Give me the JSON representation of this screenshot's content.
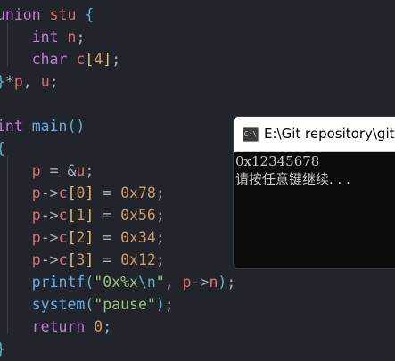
{
  "editor": {
    "lines": [
      [
        [
          "kw",
          "union"
        ],
        [
          "plain",
          " "
        ],
        [
          "id",
          "stu"
        ],
        [
          "plain",
          " "
        ],
        [
          "brace",
          "{"
        ]
      ],
      [
        [
          "plain",
          "    "
        ],
        [
          "kw",
          "int"
        ],
        [
          "plain",
          " "
        ],
        [
          "id",
          "n"
        ],
        [
          "plain",
          ";"
        ]
      ],
      [
        [
          "plain",
          "    "
        ],
        [
          "kw",
          "char"
        ],
        [
          "plain",
          " "
        ],
        [
          "id",
          "c"
        ],
        [
          "sq",
          "["
        ],
        [
          "num",
          "4"
        ],
        [
          "sq",
          "]"
        ],
        [
          "plain",
          ";"
        ]
      ],
      [
        [
          "brace",
          "}"
        ],
        [
          "plain",
          "*"
        ],
        [
          "id",
          "p"
        ],
        [
          "plain",
          ", "
        ],
        [
          "id",
          "u"
        ],
        [
          "plain",
          ";"
        ]
      ],
      [
        [
          "plain",
          ""
        ]
      ],
      [
        [
          "kw",
          "int"
        ],
        [
          "plain",
          " "
        ],
        [
          "fn",
          "main"
        ],
        [
          "paren",
          "()"
        ]
      ],
      [
        [
          "brace",
          "{"
        ]
      ],
      [
        [
          "plain",
          "    "
        ],
        [
          "id",
          "p"
        ],
        [
          "plain",
          " = &"
        ],
        [
          "id",
          "u"
        ],
        [
          "plain",
          ";"
        ]
      ],
      [
        [
          "plain",
          "    "
        ],
        [
          "id",
          "p"
        ],
        [
          "plain",
          "->"
        ],
        [
          "id",
          "c"
        ],
        [
          "sq",
          "["
        ],
        [
          "num",
          "0"
        ],
        [
          "sq",
          "]"
        ],
        [
          "plain",
          " = "
        ],
        [
          "num",
          "0x78"
        ],
        [
          "plain",
          ";"
        ]
      ],
      [
        [
          "plain",
          "    "
        ],
        [
          "id",
          "p"
        ],
        [
          "plain",
          "->"
        ],
        [
          "id",
          "c"
        ],
        [
          "sq",
          "["
        ],
        [
          "num",
          "1"
        ],
        [
          "sq",
          "]"
        ],
        [
          "plain",
          " = "
        ],
        [
          "num",
          "0x56"
        ],
        [
          "plain",
          ";"
        ]
      ],
      [
        [
          "plain",
          "    "
        ],
        [
          "id",
          "p"
        ],
        [
          "plain",
          "->"
        ],
        [
          "id",
          "c"
        ],
        [
          "sq",
          "["
        ],
        [
          "num",
          "2"
        ],
        [
          "sq",
          "]"
        ],
        [
          "plain",
          " = "
        ],
        [
          "num",
          "0x34"
        ],
        [
          "plain",
          ";"
        ]
      ],
      [
        [
          "plain",
          "    "
        ],
        [
          "id",
          "p"
        ],
        [
          "plain",
          "->"
        ],
        [
          "id",
          "c"
        ],
        [
          "sq",
          "["
        ],
        [
          "num",
          "3"
        ],
        [
          "sq",
          "]"
        ],
        [
          "plain",
          " = "
        ],
        [
          "num",
          "0x12"
        ],
        [
          "plain",
          ";"
        ]
      ],
      [
        [
          "plain",
          "    "
        ],
        [
          "fn",
          "printf"
        ],
        [
          "paren",
          "("
        ],
        [
          "str",
          "\"0x%x"
        ],
        [
          "esc",
          "\\n"
        ],
        [
          "str",
          "\""
        ],
        [
          "plain",
          ", "
        ],
        [
          "id",
          "p"
        ],
        [
          "plain",
          "->"
        ],
        [
          "id",
          "n"
        ],
        [
          "paren",
          ")"
        ],
        [
          "plain",
          ";"
        ]
      ],
      [
        [
          "plain",
          "    "
        ],
        [
          "fn",
          "system"
        ],
        [
          "paren",
          "("
        ],
        [
          "str",
          "\"pause\""
        ],
        [
          "paren",
          ")"
        ],
        [
          "plain",
          ";"
        ]
      ],
      [
        [
          "plain",
          "    "
        ],
        [
          "kw",
          "return"
        ],
        [
          "plain",
          " "
        ],
        [
          "num",
          "0"
        ],
        [
          "plain",
          ";"
        ]
      ],
      [
        [
          "brace",
          "}"
        ]
      ]
    ],
    "fold_markers": [
      0,
      5
    ]
  },
  "console": {
    "title": "E:\\Git repository\\git",
    "icon_text": "C:\\",
    "output": [
      "0x12345678",
      "请按任意键继续. . ."
    ]
  },
  "colors": {
    "background": "#21252b",
    "keyword": "#c678dd",
    "identifier": "#e06c75",
    "number": "#d19a66",
    "string": "#98c379",
    "function": "#61afef"
  }
}
